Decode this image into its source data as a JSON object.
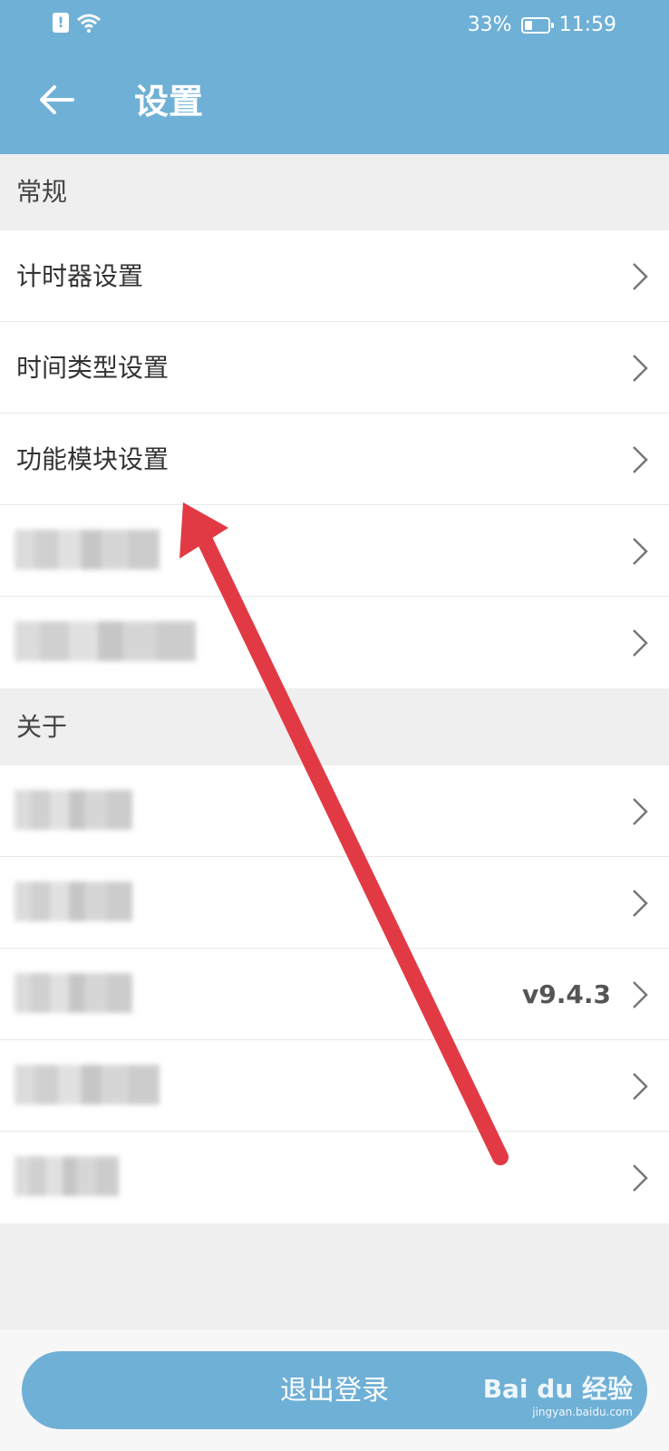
{
  "status_bar": {
    "battery": "33%",
    "time": "11:59"
  },
  "app_bar": {
    "title": "设置"
  },
  "sections": {
    "general": {
      "title": "常规",
      "items": [
        "计时器设置",
        "时间类型设置",
        "功能模块设置",
        "",
        ""
      ]
    },
    "about": {
      "title": "关于",
      "items": [
        "",
        "",
        "",
        "",
        ""
      ],
      "version_value": "v9.4.3"
    }
  },
  "logout": {
    "label": "退出登录"
  },
  "watermark": {
    "brand": "Bai du 经验",
    "url": "jingyan.baidu.com"
  },
  "colors": {
    "accent": "#6fb0d6",
    "annotation_arrow": "#e23a45"
  },
  "icons": [
    "alert-icon",
    "wifi-icon",
    "battery-icon",
    "back-arrow-icon",
    "chevron-right-icon"
  ]
}
